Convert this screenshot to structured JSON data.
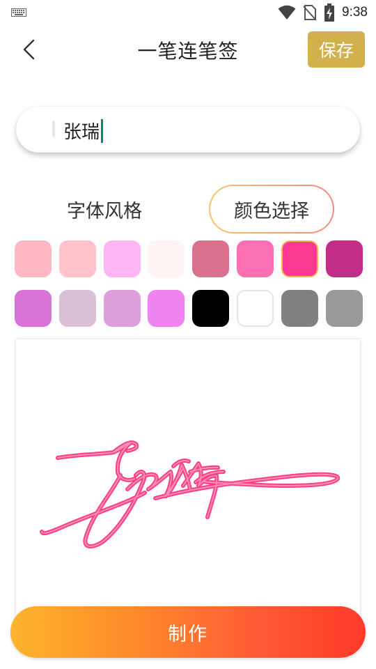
{
  "status_bar": {
    "time": "9:38",
    "icons": [
      "keyboard-icon",
      "wifi-icon",
      "no-sim-icon",
      "battery-charging-icon"
    ]
  },
  "app_bar": {
    "back_icon": "chevron-left-icon",
    "title": "一笔连笔签",
    "save_label": "保存"
  },
  "name_input": {
    "value": "张瑞"
  },
  "tabs": {
    "font_style": "字体风格",
    "color_select": "颜色选择",
    "active": "color_select"
  },
  "colors": [
    {
      "hex": "#ffb7c1"
    },
    {
      "hex": "#ffc3cb"
    },
    {
      "hex": "#fdb6f1"
    },
    {
      "hex": "#fff4f4"
    },
    {
      "hex": "#d9718f"
    },
    {
      "hex": "#fc6fb3"
    },
    {
      "hex": "#fc3994",
      "selected": true
    },
    {
      "hex": "#c22e87"
    },
    {
      "hex": "#d874d8"
    },
    {
      "hex": "#d9bfd8"
    },
    {
      "hex": "#dda0dc"
    },
    {
      "hex": "#ed84ef"
    },
    {
      "hex": "#000000"
    },
    {
      "hex": "#ffffff"
    },
    {
      "hex": "#808080"
    },
    {
      "hex": "#999999"
    }
  ],
  "signature": {
    "stroke_color": "#ff3d87",
    "highlight_color": "#ff8fb8"
  },
  "make_button": {
    "label": "制作"
  }
}
